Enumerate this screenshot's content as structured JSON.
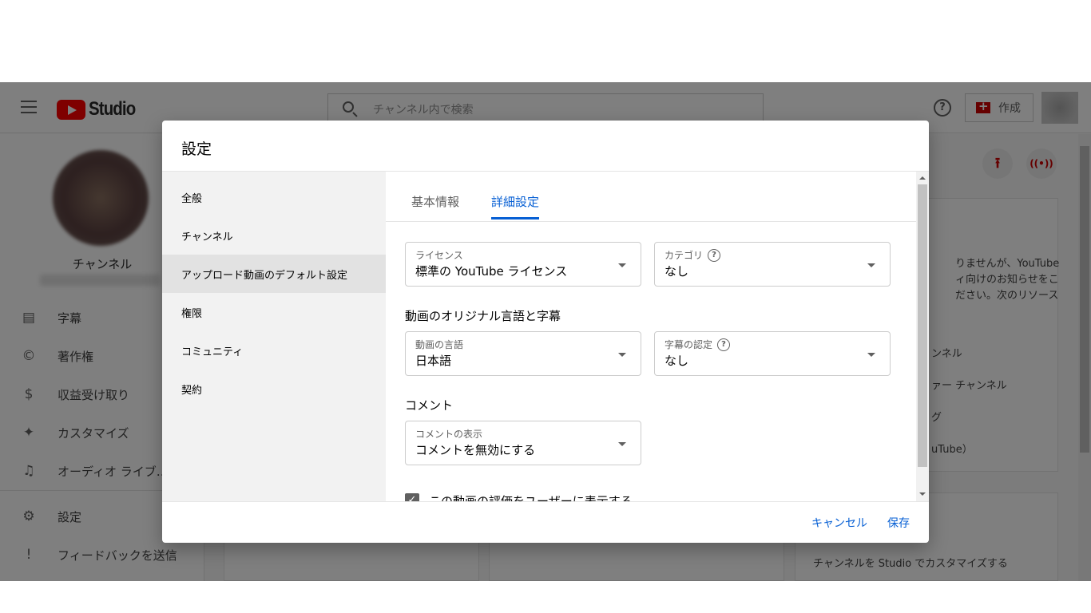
{
  "header": {
    "logo_text": "Studio",
    "search_placeholder": "チャンネル内で検索",
    "help_icon": "?",
    "create_label": "作成"
  },
  "sidebar": {
    "channel_name": "チャンネル",
    "items": [
      {
        "label": "字幕",
        "icon": "subtitles-icon",
        "glyph": "▤"
      },
      {
        "label": "著作権",
        "icon": "copyright-icon",
        "glyph": "©"
      },
      {
        "label": "収益受け取り",
        "icon": "dollar-icon",
        "glyph": "$"
      },
      {
        "label": "カスタマイズ",
        "icon": "magic-wand-icon",
        "glyph": "✦"
      },
      {
        "label": "オーディオ ライブ…",
        "icon": "audio-library-icon",
        "glyph": "♫"
      },
      {
        "label": "設定",
        "icon": "gear-icon",
        "glyph": "⚙"
      },
      {
        "label": "フィードバックを送信",
        "icon": "feedback-icon",
        "glyph": "!"
      }
    ]
  },
  "background": {
    "upload_glyph": "⭱",
    "live_glyph": "((•))",
    "card_lines": [
      "りませんが、YouTube",
      "ィ向けのお知らせをこ",
      "ださい。次のリソース"
    ],
    "card_links": [
      "ンネル",
      "ァー チャンネル",
      "グ",
      "uTube）"
    ],
    "customize_text": "チャンネルを Studio でカスタマイズする"
  },
  "dialog": {
    "title": "設定",
    "nav": [
      "全般",
      "チャンネル",
      "アップロード動画のデフォルト設定",
      "権限",
      "コミュニティ",
      "契約"
    ],
    "active_nav": 2,
    "tabs": [
      "基本情報",
      "詳細設定"
    ],
    "active_tab": 1,
    "license": {
      "label": "ライセンス",
      "value": "標準の YouTube ライセンス"
    },
    "category": {
      "label": "カテゴリ",
      "value": "なし"
    },
    "language_section": "動画のオリジナル言語と字幕",
    "video_language": {
      "label": "動画の言語",
      "value": "日本語"
    },
    "caption_cert": {
      "label": "字幕の認定",
      "value": "なし"
    },
    "comment_section": "コメント",
    "comment_visibility": {
      "label": "コメントの表示",
      "value": "コメントを無効にする"
    },
    "rating_checkbox": {
      "label": "この動画の評価をユーザーに表示する",
      "checked": true
    },
    "cancel_label": "キャンセル",
    "save_label": "保存"
  },
  "colors": {
    "accent": "#065fd4",
    "brand": "#ff0000"
  }
}
